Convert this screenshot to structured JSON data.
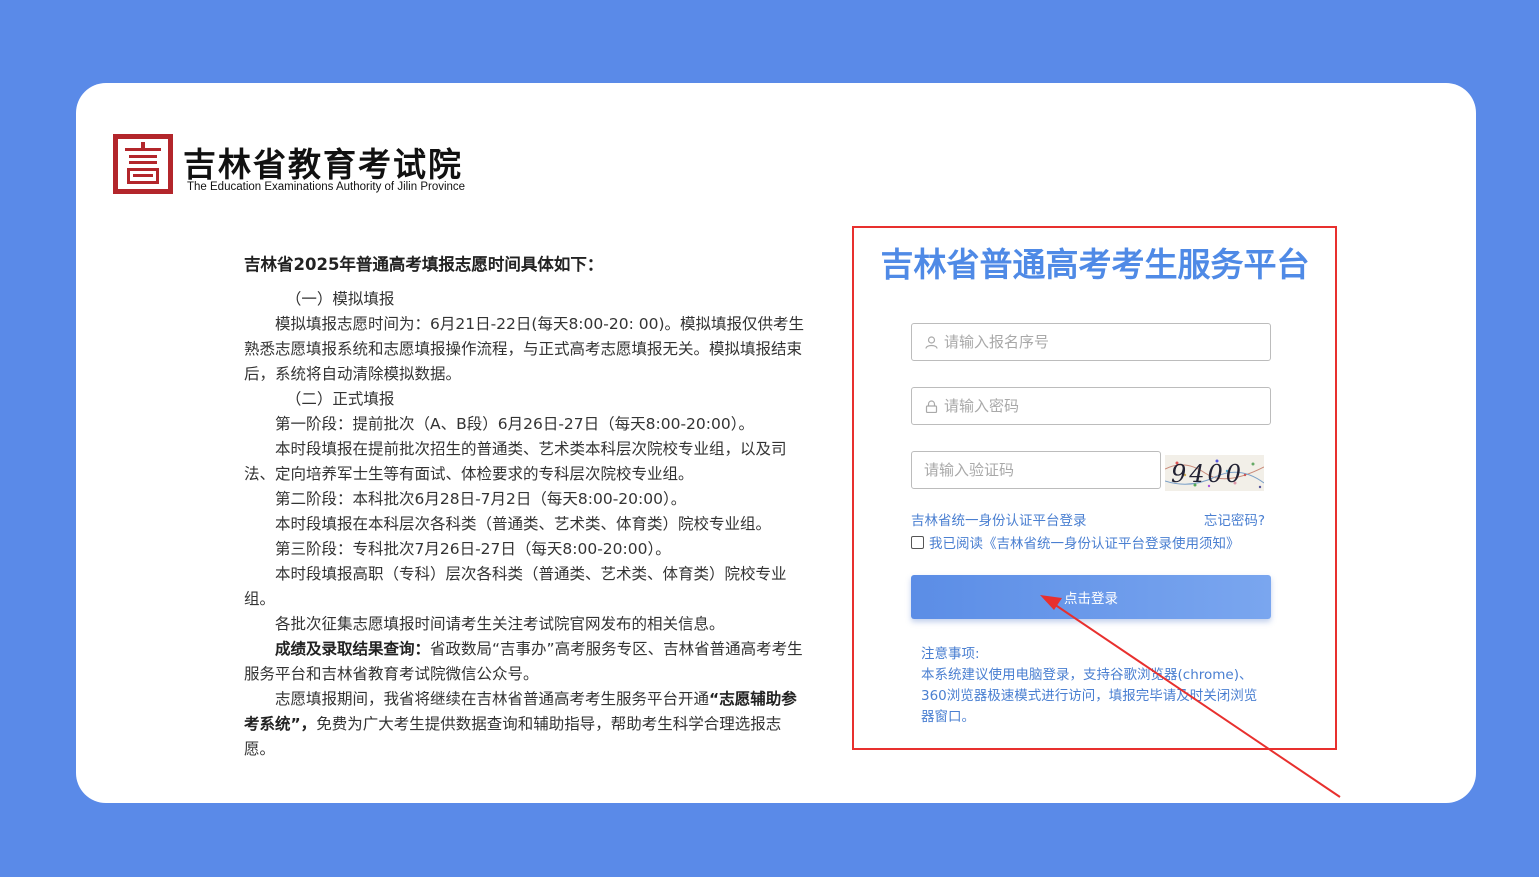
{
  "org": {
    "name_cn": "吉林省教育考试院",
    "name_en": "The Education Examinations Authority of Jilin Province"
  },
  "notice": {
    "title": "吉林省2025年普通高考填报志愿时间具体如下：",
    "s1_heading": "（一）模拟填报",
    "s1_body": "模拟填报志愿时间为：6月21日-22日(每天8:00-20: 00)。模拟填报仅供考生熟悉志愿填报系统和志愿填报操作流程，与正式高考志愿填报无关。模拟填报结束后，系统将自动清除模拟数据。",
    "s2_heading": "（二）正式填报",
    "stage1": "第一阶段：提前批次（A、B段）6月26日-27日（每天8:00-20:00）。",
    "stage1_desc": "本时段填报在提前批次招生的普通类、艺术类本科层次院校专业组，以及司法、定向培养军士生等有面试、体检要求的专科层次院校专业组。",
    "stage2": "第二阶段：本科批次6月28日-7月2日（每天8:00-20:00）。",
    "stage2_desc": "本时段填报在本科层次各科类（普通类、艺术类、体育类）院校专业组。",
    "stage3": "第三阶段：专科批次7月26日-27日（每天8:00-20:00）。",
    "stage3_desc": "本时段填报高职（专科）层次各科类（普通类、艺术类、体育类）院校专业组。",
    "solicit": "各批次征集志愿填报时间请考生关注考试院官网发布的相关信息。",
    "score_label": "成绩及录取结果查询：",
    "score_text": "省政数局“吉事办”高考服务专区、吉林省普通高考考生服务平台和吉林省教育考试院微信公众号。",
    "assist_pre": "志愿填报期间，我省将继续在吉林省普通高考考生服务平台开通",
    "assist_bold": "“志愿辅助参考系统”，",
    "assist_post": "免费为广大考生提供数据查询和辅助指导，帮助考生科学合理选报志愿。"
  },
  "login": {
    "platform_title": "吉林省普通高考考生服务平台",
    "username_placeholder": "请输入报名序号",
    "password_placeholder": "请输入密码",
    "captcha_placeholder": "请输入验证码",
    "captcha_text": "9400",
    "unified_login_link": "吉林省统一身份认证平台登录",
    "forgot_password_link": "忘记密码?",
    "agree_text": "我已阅读《吉林省统一身份认证平台登录使用须知》",
    "agree_checked": false,
    "submit_label": "点击登录",
    "notes_title": "注意事项:",
    "notes_body": "本系统建议使用电脑登录，支持谷歌浏览器(chrome)、360浏览器极速模式进行访问，填报完毕请及时关闭浏览器窗口。"
  },
  "colors": {
    "background": "#5a8ae8",
    "accent": "#4f8ae6",
    "highlight_border": "#e8302e",
    "brand_red": "#b3262b"
  }
}
